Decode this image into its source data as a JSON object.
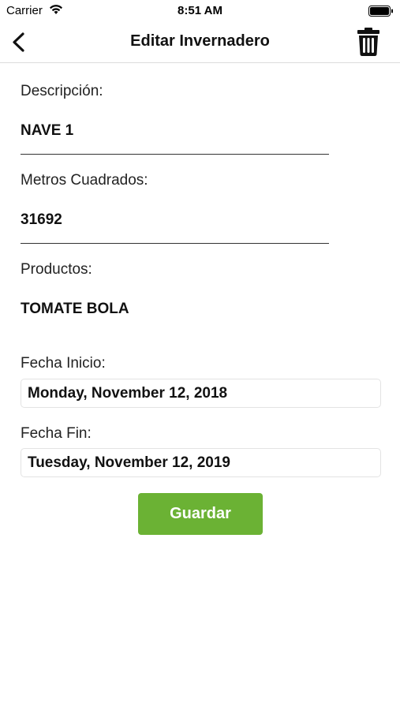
{
  "status_bar": {
    "carrier": "Carrier",
    "time": "8:51 AM",
    "icons": [
      "wifi-icon",
      "battery-icon"
    ]
  },
  "nav": {
    "title": "Editar Invernadero",
    "back_icon": "chevron-left-icon",
    "delete_icon": "trash-icon"
  },
  "form": {
    "descripcion": {
      "label": "Descripción:",
      "value": "NAVE 1"
    },
    "metros": {
      "label": "Metros Cuadrados:",
      "value": "31692"
    },
    "productos": {
      "label": "Productos:",
      "value": "TOMATE BOLA"
    },
    "fecha_inicio": {
      "label": "Fecha Inicio:",
      "value": "Monday, November 12, 2018"
    },
    "fecha_fin": {
      "label": "Fecha Fin:",
      "value": "Tuesday, November 12, 2019"
    },
    "save_label": "Guardar"
  },
  "colors": {
    "accent": "#6bb234",
    "text": "#111111",
    "divider": "#dcdcdc"
  }
}
